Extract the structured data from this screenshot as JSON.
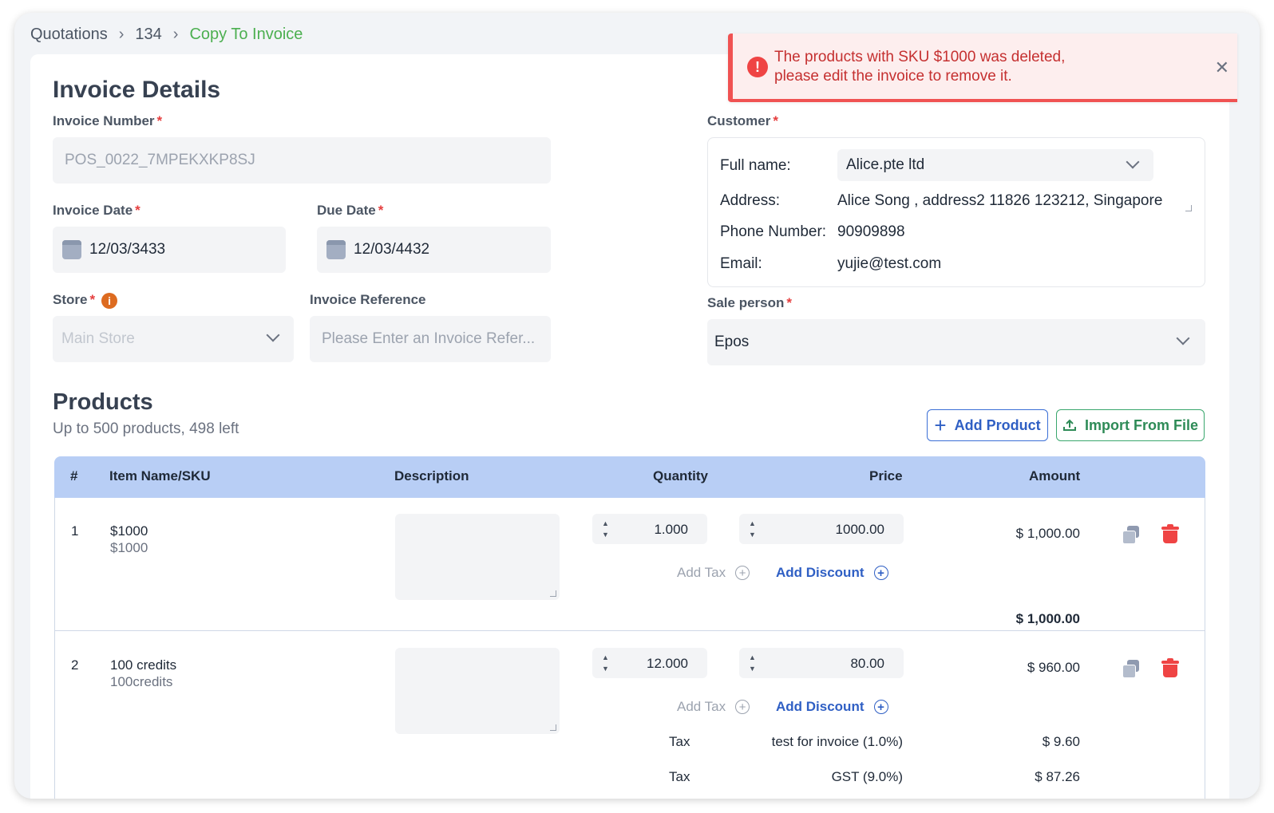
{
  "breadcrumb": {
    "items": [
      "Quotations",
      "134"
    ],
    "current": "Copy To Invoice"
  },
  "invoice": {
    "title": "Invoice Details",
    "number_label": "Invoice Number",
    "number_value": "POS_0022_7MPEKXKP8SJ",
    "date_label": "Invoice Date",
    "date_value": "12/03/3433",
    "due_label": "Due Date",
    "due_value": "12/03/4432",
    "store_label": "Store",
    "store_placeholder": "Main Store",
    "ref_label": "Invoice Reference",
    "ref_placeholder": "Please Enter an Invoice Refer..."
  },
  "customer": {
    "label": "Customer",
    "fullname_label": "Full name:",
    "fullname_value": "Alice.pte ltd",
    "address_label": "Address:",
    "address_value": "Alice Song , address2 11826 123212, Singapore",
    "phone_label": "Phone Number:",
    "phone_value": "90909898",
    "email_label": "Email:",
    "email_value": "yujie@test.com"
  },
  "sale_person": {
    "label": "Sale person",
    "value": "Epos"
  },
  "products": {
    "title": "Products",
    "subtitle": "Up to 500 products, 498 left",
    "add_button": "Add Product",
    "import_button": "Import From File",
    "columns": [
      "#",
      "Item Name/SKU",
      "Description",
      "Quantity",
      "Price",
      "Amount"
    ],
    "add_tax_label": "Add Tax",
    "add_discount_label": "Add Discount",
    "rows": [
      {
        "index": "1",
        "name": "$1000",
        "sku": "$1000",
        "quantity": "1.000",
        "price": "1000.00",
        "amount": "$ 1,000.00",
        "total": "$ 1,000.00"
      },
      {
        "index": "2",
        "name": "100 credits",
        "sku": "100credits",
        "quantity": "12.000",
        "price": "80.00",
        "amount": "$ 960.00",
        "taxes": [
          {
            "label": "Tax",
            "name": "test for invoice (1.0%)",
            "amount": "$ 9.60"
          },
          {
            "label": "Tax",
            "name": "GST (9.0%)",
            "amount": "$ 87.26"
          }
        ]
      }
    ]
  },
  "toast": {
    "line1": "The products with SKU $1000 was deleted,",
    "line2": "please edit the invoice to remove it."
  },
  "colors": {
    "accent": "#2f5fc4",
    "success": "#4caf50",
    "danger": "#ef4444",
    "table_header": "#b8cef5"
  }
}
